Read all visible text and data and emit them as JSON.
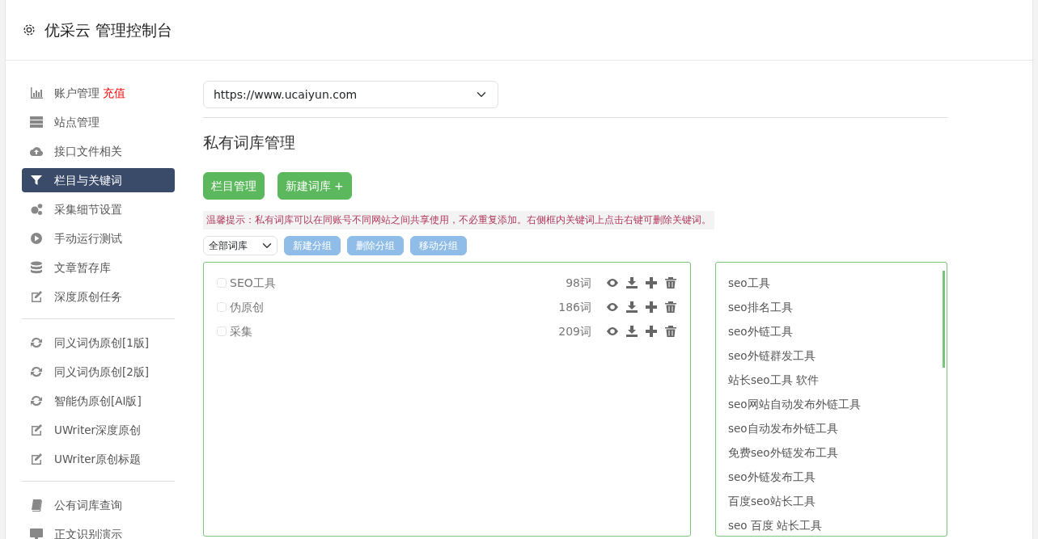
{
  "header": {
    "title": "优采云 管理控制台"
  },
  "sidebar": {
    "groups": [
      [
        {
          "kind": "bars",
          "label": "账户管理",
          "badge": "充值",
          "selected": false
        },
        {
          "kind": "server",
          "label": "站点管理",
          "selected": false
        },
        {
          "kind": "cloud",
          "label": "接口文件相关",
          "selected": false
        },
        {
          "kind": "filter",
          "label": "栏目与关键词",
          "selected": true
        },
        {
          "kind": "gears",
          "label": "采集细节设置",
          "selected": false
        },
        {
          "kind": "play",
          "label": "手动运行测试",
          "selected": false
        },
        {
          "kind": "database",
          "label": "文章暂存库",
          "selected": false
        },
        {
          "kind": "edit",
          "label": "深度原创任务",
          "selected": false
        }
      ],
      [
        {
          "kind": "refresh",
          "label": "同义词伪原创[1版]",
          "selected": false
        },
        {
          "kind": "refresh",
          "label": "同义词伪原创[2版]",
          "selected": false
        },
        {
          "kind": "refresh",
          "label": "智能伪原创[AI版]",
          "selected": false
        },
        {
          "kind": "edit",
          "label": "UWriter深度原创",
          "selected": false
        },
        {
          "kind": "edit",
          "label": "UWriter原创标题",
          "selected": false
        }
      ],
      [
        {
          "kind": "book",
          "label": "公有词库查询",
          "selected": false
        },
        {
          "kind": "monitor",
          "label": "正文识别演示",
          "selected": false
        }
      ]
    ]
  },
  "site_select": {
    "value": "https://www.ucaiyun.com"
  },
  "heading": "私有词库管理",
  "buttons": [
    "栏目管理",
    "新建词库 +"
  ],
  "tip": "温馨提示：私有词库可以在同账号不同网站之间共享使用，不必重复添加。右侧框内关键词上点击右键可删除关键词。",
  "library_select": {
    "value": "全部词库"
  },
  "group_buttons": [
    "新建分组",
    "删除分组",
    "移动分组"
  ],
  "libraries": [
    {
      "name": "SEO工具",
      "count": "98词",
      "checked": false
    },
    {
      "name": "伪原创",
      "count": "186词",
      "checked": false
    },
    {
      "name": "采集",
      "count": "209词",
      "checked": false
    }
  ],
  "keywords": [
    "seo工具",
    "seo排名工具",
    "seo外链工具",
    "seo外链群发工具",
    "站长seo工具 软件",
    "seo网站自动发布外链工具",
    "seo自动发布外链工具",
    "免费seo外链发布工具",
    "seo外链发布工具",
    "百度seo站长工具",
    "seo 百度 站长工具"
  ]
}
